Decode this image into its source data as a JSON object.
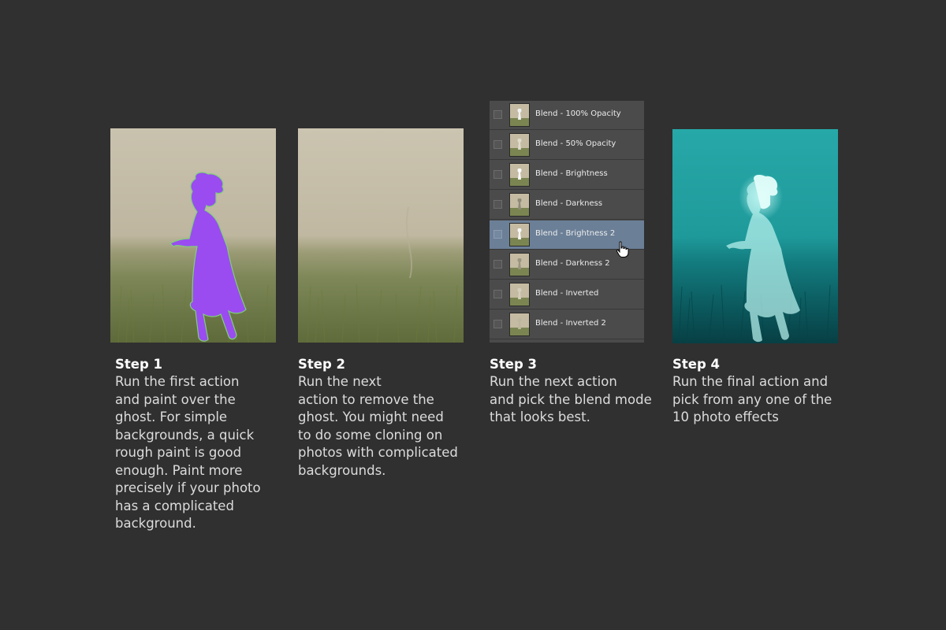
{
  "steps": [
    {
      "title": "Step 1",
      "lines": [
        "Run the first action",
        "and paint over the",
        "ghost. For simple",
        "backgrounds, a quick",
        "rough paint is good",
        "enough. Paint more",
        "precisely if your photo",
        "has a complicated",
        "background."
      ]
    },
    {
      "title": "Step 2",
      "lines": [
        "Run the next",
        "action to remove the",
        "ghost. You might need",
        "to do some cloning on",
        "photos with complicated",
        "backgrounds."
      ]
    },
    {
      "title": "Step 3",
      "lines": [
        "Run the next action",
        "and pick the blend mode",
        "that looks best."
      ]
    },
    {
      "title": "Step 4",
      "lines": [
        "Run the final action and",
        "pick from any one of the",
        "10 photo effects"
      ]
    }
  ],
  "layers": [
    {
      "label": "Blend - 100% Opacity",
      "selected": false
    },
    {
      "label": "Blend - 50% Opacity",
      "selected": false
    },
    {
      "label": "Blend - Brightness",
      "selected": false
    },
    {
      "label": "Blend - Darkness",
      "selected": false
    },
    {
      "label": "Blend - Brightness 2",
      "selected": true
    },
    {
      "label": "Blend - Darkness 2",
      "selected": false
    },
    {
      "label": "Blend - Inverted",
      "selected": false
    },
    {
      "label": "Blend - Inverted 2",
      "selected": false
    }
  ],
  "icons": {
    "cursor": "hand-pointer-icon",
    "layer_visibility": "checkbox-icon"
  },
  "colors": {
    "background": "#303030",
    "selected_layer": "#6b7f97",
    "paint_overlay": "#9a4cf0",
    "effect_tint": "#1fa7a8"
  }
}
